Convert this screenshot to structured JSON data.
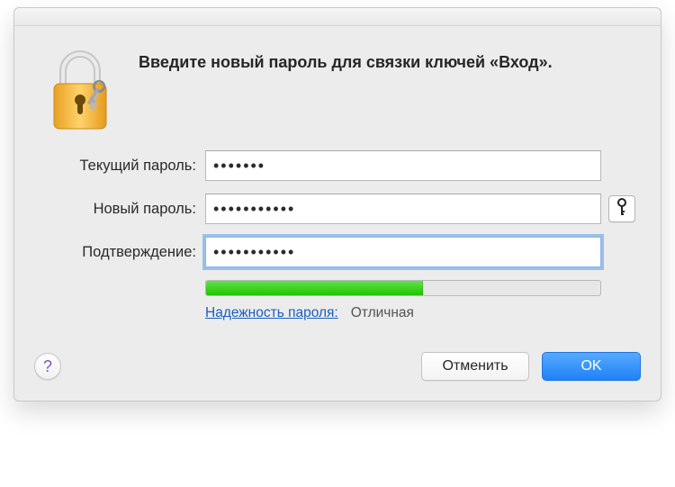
{
  "header": {
    "title": "Введите новый пароль для связки ключей «Вход»."
  },
  "fields": {
    "current": {
      "label": "Текущий пароль:",
      "value": "•••••••"
    },
    "new": {
      "label": "Новый пароль:",
      "value": "•••••••••••"
    },
    "verify": {
      "label": "Подтверждение:",
      "value": "•••••••••••"
    }
  },
  "strength": {
    "label": "Надежность пароля:",
    "value": "Отличная",
    "percent": 55
  },
  "footer": {
    "help": "?",
    "cancel": "Отменить",
    "ok": "OK"
  }
}
